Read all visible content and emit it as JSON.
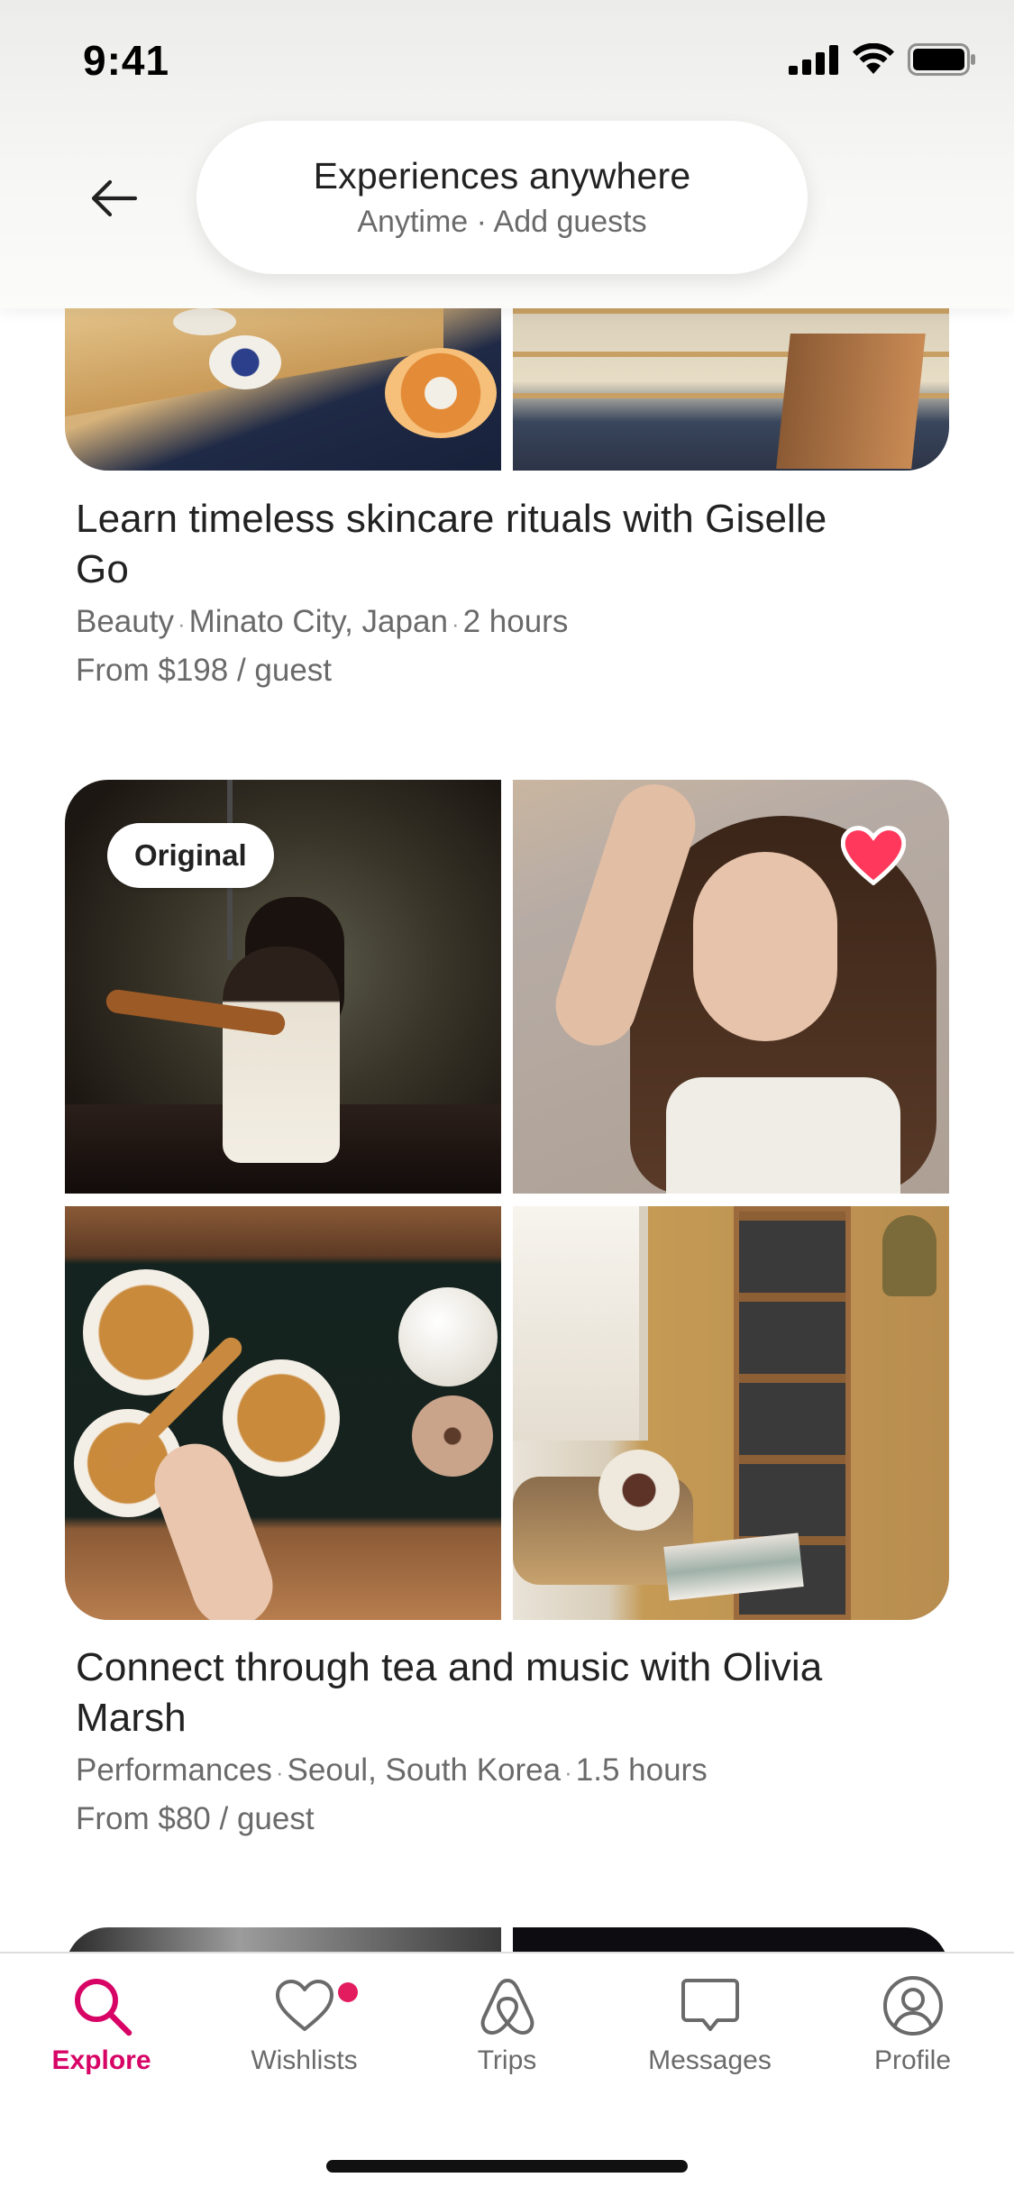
{
  "status_bar": {
    "time": "9:41"
  },
  "header": {
    "search_title": "Experiences anywhere",
    "search_subtitle": "Anytime · Add guests"
  },
  "listings": [
    {
      "title": "Learn timeless skincare rituals with Giselle Go",
      "category": "Beauty",
      "location": "Minato City, Japan",
      "duration": "2 hours",
      "price": "From $198 / guest"
    },
    {
      "badge": "Original",
      "saved": true,
      "title": "Connect through tea and music with Olivia Marsh",
      "category": "Performances",
      "location": "Seoul, South Korea",
      "duration": "1.5 hours",
      "price": "From $80 / guest"
    }
  ],
  "tabs": [
    {
      "label": "Explore",
      "icon": "search-icon",
      "active": true
    },
    {
      "label": "Wishlists",
      "icon": "heart-icon",
      "badge_dot": true
    },
    {
      "label": "Trips",
      "icon": "airbnb-logo-icon"
    },
    {
      "label": "Messages",
      "icon": "message-icon"
    },
    {
      "label": "Profile",
      "icon": "profile-icon"
    }
  ],
  "colors": {
    "accent": "#d70466",
    "heart": "#ff385c",
    "text_primary": "#222222",
    "text_secondary": "#6a6a6a"
  }
}
